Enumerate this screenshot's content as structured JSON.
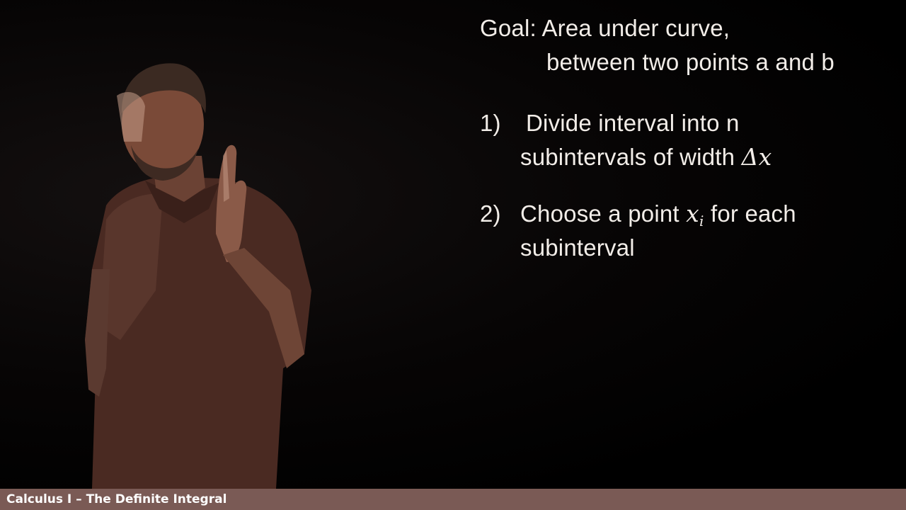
{
  "slide": {
    "goal_label": "Goal:",
    "goal_text": "Area under curve,",
    "goal_text_2": "between two points a and b",
    "step1_number": "1)",
    "step1_line1": "Divide interval into n",
    "step1_line2_text": "subintervals of width ",
    "step1_line2_math": "Δx",
    "step2_number": "2)",
    "step2_line1_text": "Choose a point ",
    "step2_line1_math_base": "x",
    "step2_line1_math_sub": "i",
    "step2_line1_tail": " for each",
    "step2_line2": "subinterval"
  },
  "footer": {
    "title": "Calculus I – The Definite Integral"
  },
  "colors": {
    "background": "#000000",
    "text": "#f2ede8",
    "footer_bar": "#7a5a55"
  }
}
